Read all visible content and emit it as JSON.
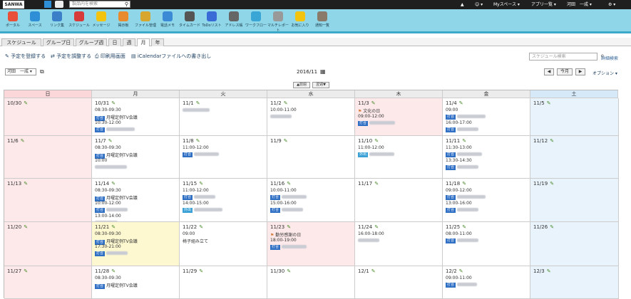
{
  "topbar": {
    "logo": "SANWA",
    "search_placeholder": "製品内を検索",
    "myspace": "Myスペース ▾",
    "apps": "アプリ一覧 ▾",
    "user": "河田　一成 ▾",
    "settings": "⚙ ▾"
  },
  "appbar": [
    {
      "label": "ポータル",
      "color": "#e8503a"
    },
    {
      "label": "スペース",
      "color": "#2e8fd6"
    },
    {
      "label": "リンク集",
      "color": "#3a7fc7"
    },
    {
      "label": "スケジュール",
      "color": "#d63a3a"
    },
    {
      "label": "メッセージ",
      "color": "#f2c40f"
    },
    {
      "label": "掲示板",
      "color": "#e88a2e"
    },
    {
      "label": "ファイル管理",
      "color": "#d6a62e"
    },
    {
      "label": "電話メモ",
      "color": "#3a8ad6"
    },
    {
      "label": "タイムカード",
      "color": "#555555"
    },
    {
      "label": "ToDoリスト",
      "color": "#3a6ad6"
    },
    {
      "label": "アドレス帳",
      "color": "#666666"
    },
    {
      "label": "ワークフロー",
      "color": "#3aa6d6"
    },
    {
      "label": "マルチレポート",
      "color": "#999999"
    },
    {
      "label": "お気に入り",
      "color": "#f2c40f"
    },
    {
      "label": "通知一覧",
      "color": "#8a7a6a"
    }
  ],
  "tabs": [
    "スケジュール",
    "グループ日",
    "グループ週",
    "日",
    "週",
    "月",
    "年"
  ],
  "actions": {
    "register": "予定を登録する",
    "adjust": "予定を調整する",
    "print": "印刷用画面",
    "ical": "iCalendarファイルへの書き出し",
    "search_placeholder": "スケジュール検索",
    "detail_search": "詳細検索"
  },
  "controls": {
    "user": "河田　一成 ▾",
    "month": "2016/11",
    "today": "今月",
    "options": "オプション ▾",
    "prev_week": "▲前週",
    "next_week": "翌週▼"
  },
  "weekdays": [
    "日",
    "月",
    "火",
    "水",
    "木",
    "金",
    "土"
  ],
  "weeks": [
    [
      {
        "d": "10/30"
      },
      {
        "d": "10/31",
        "ev": [
          {
            "t": "08:30-09:30"
          },
          {
            "tag": "打合",
            "s": "月曜定例TV会議"
          },
          {
            "t": "10:30-12:00"
          },
          {
            "tag": "打合",
            "b": 40
          }
        ]
      },
      {
        "d": "11/1",
        "ev": [
          {
            "b": 38
          }
        ]
      },
      {
        "d": "11/2",
        "ev": [
          {
            "t": "10:00-11:00"
          },
          {
            "b": 30
          }
        ]
      },
      {
        "d": "11/3",
        "ev": [
          {
            "f": "文化の日"
          },
          {
            "t": "09:00-12:00"
          },
          {
            "tag": "打合",
            "b": 36
          }
        ]
      },
      {
        "d": "11/4",
        "ev": [
          {
            "t": "09:00"
          },
          {
            "tag": "打合",
            "b": 40
          },
          {
            "t": "16:00-17:00"
          },
          {
            "tag": "打合",
            "b": 30
          }
        ]
      },
      {
        "d": "11/5"
      }
    ],
    [
      {
        "d": "11/6"
      },
      {
        "d": "11/7",
        "ev": [
          {
            "t": "08:30-09:30"
          },
          {
            "tag": "打合",
            "s": "月曜定例TV会議"
          },
          {
            "t": "10:00"
          },
          {
            "b": 45
          }
        ]
      },
      {
        "d": "11/8",
        "ev": [
          {
            "t": "11:00-12:00"
          },
          {
            "tag": "打合",
            "b": 35
          }
        ]
      },
      {
        "d": "11/9"
      },
      {
        "d": "11/10",
        "ev": [
          {
            "t": "11:00-12:00"
          },
          {
            "tag": "外出",
            "b": 35
          }
        ]
      },
      {
        "d": "11/11",
        "ev": [
          {
            "t": "11:30-13:00"
          },
          {
            "tag": "打合",
            "b": 35
          },
          {
            "t": "13:30-14:30"
          },
          {
            "tag": "打合",
            "b": 30
          }
        ]
      },
      {
        "d": "11/12"
      }
    ],
    [
      {
        "d": "11/13"
      },
      {
        "d": "11/14",
        "ev": [
          {
            "t": "08:30-09:30"
          },
          {
            "tag": "打合",
            "s": "月曜定例TV会議"
          },
          {
            "t": "10:00-12:00"
          },
          {
            "tag": "打合",
            "b": 30
          },
          {
            "t": "13:00-14:00"
          },
          {
            "b": 32
          }
        ]
      },
      {
        "d": "11/15",
        "ev": [
          {
            "t": "11:00-12:00"
          },
          {
            "tag": "打合",
            "b": 30
          },
          {
            "t": "14:00-15:00"
          },
          {
            "tag": "外出",
            "b": 40
          }
        ]
      },
      {
        "d": "11/16",
        "ev": [
          {
            "t": "10:00-11:00"
          },
          {
            "tag": "打合",
            "b": 35
          },
          {
            "t": "15:00-16:00"
          },
          {
            "tag": "打合",
            "b": 30
          }
        ]
      },
      {
        "d": "11/17"
      },
      {
        "d": "11/18",
        "ev": [
          {
            "t": "09:00-12:00"
          },
          {
            "tag": "打合",
            "b": 40
          },
          {
            "t": "13:00-16:00"
          },
          {
            "tag": "打合",
            "b": 30
          }
        ]
      },
      {
        "d": "11/19"
      }
    ],
    [
      {
        "d": "11/20"
      },
      {
        "d": "11/21",
        "ev": [
          {
            "t": "08:30-09:30"
          },
          {
            "tag": "打合",
            "s": "月曜定例TV会議"
          },
          {
            "t": "17:30-21:00"
          },
          {
            "tag": "打合",
            "b": 30
          }
        ]
      },
      {
        "d": "11/22",
        "ev": [
          {
            "t": "09:00"
          },
          {
            "s": "椅子組み立て"
          }
        ]
      },
      {
        "d": "11/23",
        "ev": [
          {
            "f": "勤労感謝の日"
          },
          {
            "t": "18:00-19:00"
          },
          {
            "tag": "打合",
            "b": 35
          }
        ]
      },
      {
        "d": "11/24",
        "ev": [
          {
            "t": "16:00-18:00"
          },
          {
            "b": 30
          }
        ]
      },
      {
        "d": "11/25",
        "ev": [
          {
            "t": "08:00-11:00"
          },
          {
            "tag": "打合",
            "b": 30
          }
        ]
      },
      {
        "d": "11/26"
      }
    ],
    [
      {
        "d": "11/27"
      },
      {
        "d": "11/28",
        "ev": [
          {
            "t": "08:30-09:30"
          },
          {
            "tag": "打合",
            "s": "月曜定例TV会議"
          }
        ]
      },
      {
        "d": "11/29"
      },
      {
        "d": "11/30"
      },
      {
        "d": "12/1"
      },
      {
        "d": "12/2",
        "ev": [
          {
            "t": "09:00-11:00"
          },
          {
            "tag": "打合",
            "b": 28
          }
        ]
      },
      {
        "d": "12/3"
      }
    ]
  ]
}
